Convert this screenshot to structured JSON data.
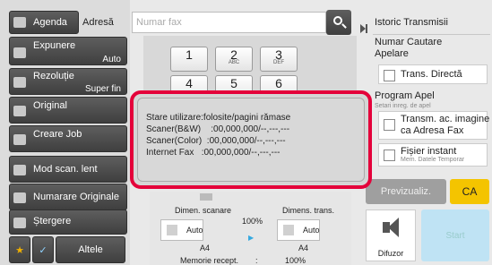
{
  "header": {
    "agenda_label": "Agenda",
    "adresa_label": "Adresă",
    "fax_placeholder": "Numar fax"
  },
  "left_buttons": [
    {
      "label": "Expunere",
      "value": "Auto"
    },
    {
      "label": "Rezoluție",
      "value": "Super fin"
    },
    {
      "label": "Original",
      "value": ""
    },
    {
      "label": "Creare Job",
      "value": ""
    },
    {
      "label": "Mod scan. lent",
      "value": ""
    },
    {
      "label": "Numarare Originale",
      "value": ""
    },
    {
      "label": "Ștergere",
      "value": ""
    }
  ],
  "bottom": {
    "altele": "Altele"
  },
  "keypad": [
    {
      "digit": "1",
      "letters": ""
    },
    {
      "digit": "2",
      "letters": "ABC"
    },
    {
      "digit": "3",
      "letters": "DEF"
    },
    {
      "digit": "4",
      "letters": ""
    },
    {
      "digit": "5",
      "letters": ""
    },
    {
      "digit": "6",
      "letters": ""
    }
  ],
  "popup": {
    "line1": "Stare utilizare:folosite/pagini rămase",
    "line2": "Scaner(B&W)    :00,000,000/--,---,---",
    "line3": "Scaner(Color)  :00,000,000/--,---,---",
    "line4": "Internet Fax   :00,000,000/--,---,---"
  },
  "scan_panel": {
    "dimens_scanare": "Dimen. scanare",
    "dimens_trans": "Dimens. trans.",
    "ratio": "100%",
    "scan_size": "Auto",
    "trans_size": "Auto",
    "scan_paper": "A4",
    "trans_paper": "A4",
    "memory_label": "Memorie recept.",
    "memory_sep": ":",
    "memory_value": "100%"
  },
  "right_panel": {
    "istoric": "Istoric Transmisii",
    "numar_cautare": "Numar Cautare\nApelare",
    "trans_directa": "Trans. Directă",
    "program_apel": "Program Apel",
    "setari_inreg": "Setari inreg. de apel",
    "transm_imagine": "Transm. ac. imagine\nca Adresa Fax",
    "fisier_instant": "Fișier instant",
    "mem_datele": "Mem. Datele Temporar",
    "previzualiz": "Previzualiz.",
    "ca": "CA",
    "difuzor": "Difuzor",
    "start": "Start"
  },
  "colors": {
    "accent_red": "#e4003a",
    "ca_yellow": "#f4c400",
    "start_blue": "#bfe3f4"
  }
}
